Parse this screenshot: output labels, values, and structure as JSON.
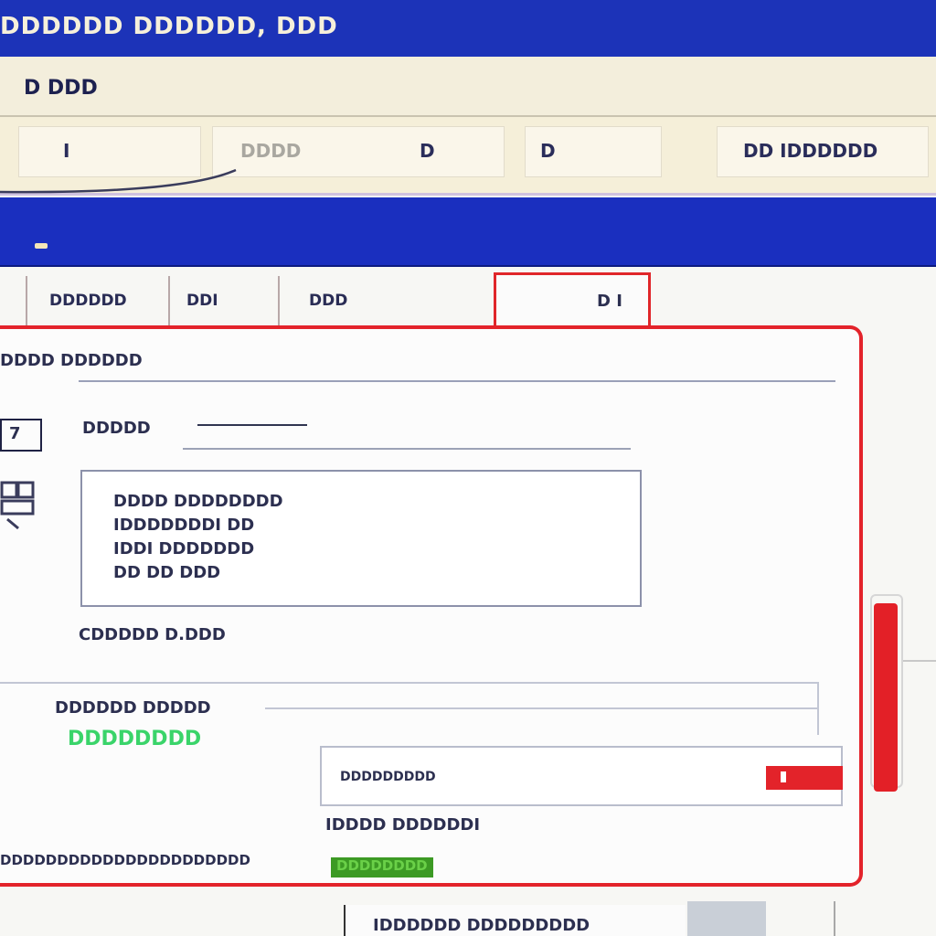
{
  "window": {
    "title": "DDDDDD DDDDDD, DDD"
  },
  "menubar": {
    "item": "D DDD"
  },
  "toolbar": {
    "field1": "I",
    "field2": "DDDD",
    "toggle": "D",
    "toggle2": "D",
    "right_text": "DD IDDDDDD"
  },
  "tabs": [
    {
      "label": "DDDDDD"
    },
    {
      "label": "DDI"
    },
    {
      "label": "DDD"
    },
    {
      "label": "D I"
    }
  ],
  "dialog": {
    "header": "DDDD DDDDDD",
    "row_label": "DDDDD",
    "side_value": "7",
    "text_lines": [
      "DDDD DDDDDDDD",
      "IDDDDDDDI DD",
      "IDDI DDDDDDD",
      "DD DD DDD"
    ],
    "link_text": "CDDDDD D.DDD",
    "section_label": "DDDDDD DDDDD",
    "status_value": "DDDDDDDD",
    "dropdown_value": "DDDDDDDDD",
    "hint_text": "IDDDD DDDDDDI",
    "footer_text": "DDDDDDDDDDDDDDDDDDDDDD",
    "footer_badge": "DDDDDDDD",
    "bottom_text": "IDDDDDD DDDDDDDDD"
  },
  "colors": {
    "titlebar": "#1c33b8",
    "accent_red": "#e3232a",
    "status_green": "#3ad46a"
  }
}
